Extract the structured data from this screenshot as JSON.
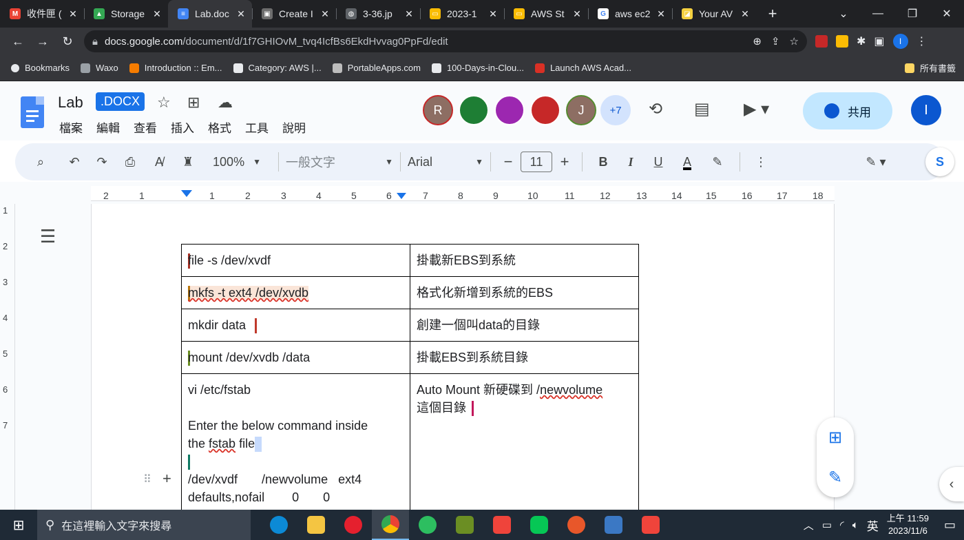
{
  "tabs": [
    {
      "label": "收件匣 (",
      "fav_color": "#ea4335",
      "fav_text": "M"
    },
    {
      "label": "Storage",
      "fav_color": "#34a853",
      "fav_text": "▲"
    },
    {
      "label": "Lab.doc",
      "fav_color": "#4285f4",
      "fav_text": "≡",
      "active": true
    },
    {
      "label": "Create I",
      "fav_color": "#6d6d6d",
      "fav_text": "▣"
    },
    {
      "label": "3-36.jp",
      "fav_color": "#5f6368",
      "fav_text": "◍"
    },
    {
      "label": "2023-1",
      "fav_color": "#fbbc04",
      "fav_text": "▭"
    },
    {
      "label": "AWS St",
      "fav_color": "#fbbc04",
      "fav_text": "▭"
    },
    {
      "label": "aws ec2",
      "fav_color": "#ffffff",
      "fav_text": "G"
    },
    {
      "label": "Your AV",
      "fav_color": "#f4d03f",
      "fav_text": "◪"
    }
  ],
  "address": {
    "domain": "docs.google.com",
    "path": "/document/d/1f7GHIOvM_tvq4IcfBs6EkdHvvag0PpFd/edit"
  },
  "bookmarks": [
    {
      "label": "Bookmarks",
      "color": "#e8eaed"
    },
    {
      "label": "Waxo",
      "color": "#9aa0a6"
    },
    {
      "label": "Introduction :: Em...",
      "color": "#f57c00"
    },
    {
      "label": "Category: AWS |...",
      "color": "#e8eaed"
    },
    {
      "label": "PortableApps.com",
      "color": "#bdbdbd"
    },
    {
      "label": "100-Days-in-Clou...",
      "color": "#e8eaed"
    },
    {
      "label": "Launch AWS Acad...",
      "color": "#d93025"
    }
  ],
  "bookmarks_right": "所有書籤",
  "doc": {
    "title": "Lab",
    "badge": ".DOCX",
    "menus": [
      "檔案",
      "編輯",
      "查看",
      "插入",
      "格式",
      "工具",
      "說明"
    ],
    "collaborators": [
      {
        "initial": "R",
        "color": "#8d6e63"
      },
      {
        "initial": "",
        "color": "#1e7e34"
      },
      {
        "initial": "",
        "color": "#9c27b0"
      },
      {
        "initial": "",
        "color": "#c62828"
      },
      {
        "initial": "J",
        "color": "#8d6e63"
      }
    ],
    "more_count": "+7",
    "share_label": "共用",
    "user_initial": "I"
  },
  "toolbar": {
    "zoom": "100%",
    "style": "一般文字",
    "font": "Arial",
    "size": "11",
    "minus": "−",
    "plus": "+",
    "bold": "B",
    "italic": "I",
    "underline": "U",
    "textcolor": "A"
  },
  "ruler": [
    "2",
    "1",
    "1",
    "2",
    "3",
    "4",
    "5",
    "6",
    "7",
    "8",
    "9",
    "10",
    "11",
    "12",
    "13",
    "14",
    "15",
    "16",
    "17",
    "18"
  ],
  "vruler": [
    "1",
    "2",
    "3",
    "4",
    "5",
    "6",
    "7"
  ],
  "table": [
    {
      "cmd": "file -s /dev/xvdf",
      "desc": "掛載新EBS到系統"
    },
    {
      "cmd": "mkfs -t ext4 /dev/xvdb",
      "desc": "格式化新增到系統的EBS"
    },
    {
      "cmd": "mkdir data",
      "desc": "創建一個叫data的目錄"
    },
    {
      "cmd": "mount /dev/xvdb /data",
      "desc": "掛載EBS到系統目錄"
    }
  ],
  "last_row": {
    "line1": "vi /etc/fstab",
    "line2": "Enter the below command inside",
    "line3a": "the ",
    "line3b": "fstab",
    "line3c": " file",
    "line4": "/dev/xvdf       /newvolume   ext4",
    "line5": "defaults,nofail        0       0",
    "desc1a": "Auto Mount 新硬碟到 /",
    "desc1b": "newvolume",
    "desc2": "這個目錄"
  },
  "taskbar": {
    "search_placeholder": "在這裡輸入文字來搜尋",
    "ime": "英",
    "time": "上午 11:59",
    "date": "2023/11/6"
  }
}
